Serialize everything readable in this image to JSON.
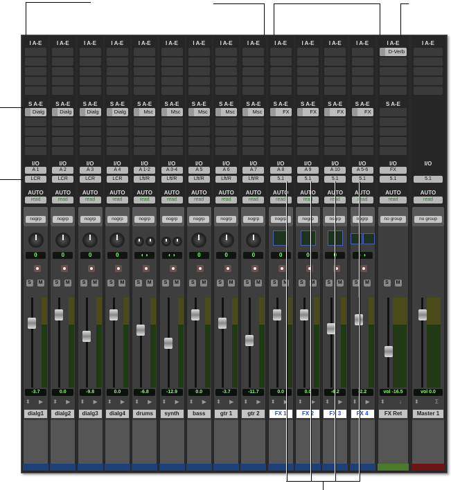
{
  "labels": {
    "inserts": "I A-E",
    "sends": "S A-E",
    "io": "I/O",
    "auto": "AUTO"
  },
  "colors": {
    "audio": "#1e3f78",
    "aux": "#1e3f78",
    "fxret": "#4b7a2a",
    "master": "#6b1515"
  },
  "channels": [
    {
      "name": "dialg1",
      "send": "Dialg",
      "input": "A 1",
      "output": "LCR",
      "auto": "read",
      "group": "nogrp",
      "pan": "mono",
      "pan_text": "0",
      "volume": "-3.7",
      "db": -3.7,
      "kind": "audio"
    },
    {
      "name": "dialg2",
      "send": "Dialg",
      "input": "A 2",
      "output": "LCR",
      "auto": "read",
      "group": "nogrp",
      "pan": "mono",
      "pan_text": "0",
      "volume": "0.0",
      "db": 0,
      "kind": "audio"
    },
    {
      "name": "dialg3",
      "send": "Dialg",
      "input": "A 3",
      "output": "LCR",
      "auto": "read",
      "group": "nogrp",
      "pan": "mono",
      "pan_text": "0",
      "volume": "-9.8",
      "db": -9.8,
      "kind": "audio"
    },
    {
      "name": "dialg4",
      "send": "Dialg",
      "input": "A 4",
      "output": "LCR",
      "auto": "read",
      "group": "nogrp",
      "pan": "mono",
      "pan_text": "0",
      "volume": "0.0",
      "db": 0,
      "kind": "audio"
    },
    {
      "name": "drums",
      "send": "Msc",
      "input": "A 1-2",
      "output": "Lft/R",
      "auto": "read",
      "group": "nogrp",
      "pan": "stereo",
      "pan_text": "◖ ◗",
      "volume": "-6.8",
      "db": -6.8,
      "kind": "audio"
    },
    {
      "name": "synth",
      "send": "Msc",
      "input": "A 3-4",
      "output": "Lft/R",
      "auto": "read",
      "group": "nogrp",
      "pan": "stereo",
      "pan_text": "◖ ◗",
      "volume": "-12.9",
      "db": -12.9,
      "kind": "audio"
    },
    {
      "name": "bass",
      "send": "Msc",
      "input": "A 5",
      "output": "Lft/R",
      "auto": "read",
      "group": "nogrp",
      "pan": "mono",
      "pan_text": "0",
      "volume": "0.0",
      "db": 0,
      "kind": "audio"
    },
    {
      "name": "gtr 1",
      "send": "Msc",
      "input": "A 6",
      "output": "Lft/R",
      "auto": "read",
      "group": "nogrp",
      "pan": "mono",
      "pan_text": "0",
      "volume": "-3.7",
      "db": -3.7,
      "kind": "audio"
    },
    {
      "name": "gtr 2",
      "send": "Msc",
      "input": "A 7",
      "output": "Lft/R",
      "auto": "read",
      "group": "nogrp",
      "pan": "mono",
      "pan_text": "0",
      "volume": "-11.7",
      "db": -11.7,
      "kind": "audio"
    },
    {
      "name": "FX 1",
      "send": "FX",
      "input": "A 8",
      "output": "5.1",
      "auto": "read",
      "group": "nogrp",
      "pan": "surround",
      "pan_text": "0",
      "volume": "0.0",
      "db": 0,
      "kind": "aux"
    },
    {
      "name": "FX 2",
      "send": "FX",
      "input": "A 9",
      "output": "5.1",
      "auto": "read",
      "group": "nogrp",
      "pan": "surround",
      "pan_text": "0",
      "volume": "0.0",
      "db": 0,
      "kind": "aux"
    },
    {
      "name": "FX 3",
      "send": "FX",
      "input": "A 10",
      "output": "5.1",
      "auto": "read",
      "group": "nogrp",
      "pan": "surround",
      "pan_text": "0",
      "volume": "-6.2",
      "db": -6.2,
      "kind": "aux"
    },
    {
      "name": "FX 4",
      "send": "FX",
      "input": "A 5-6",
      "output": "5.1",
      "auto": "read",
      "group": "nogrp",
      "pan": "surround2",
      "pan_text": "◖ ◗",
      "volume": "-2.2",
      "db": -2.2,
      "kind": "aux"
    },
    {
      "name": "FX Ret",
      "insert": "D-Verb",
      "input": "FX",
      "output": "5.1",
      "auto": "read",
      "group": "no group",
      "pan": "none",
      "volume": "vol  -16.5",
      "db": -16.5,
      "kind": "fxret",
      "arrow": "↓"
    },
    {
      "name": "Master 1",
      "input": "",
      "output": "5.1",
      "auto": "read",
      "group": "no group",
      "pan": "none",
      "volume": "vol  0.0",
      "db": 0,
      "kind": "master",
      "arrow": "Σ"
    }
  ]
}
